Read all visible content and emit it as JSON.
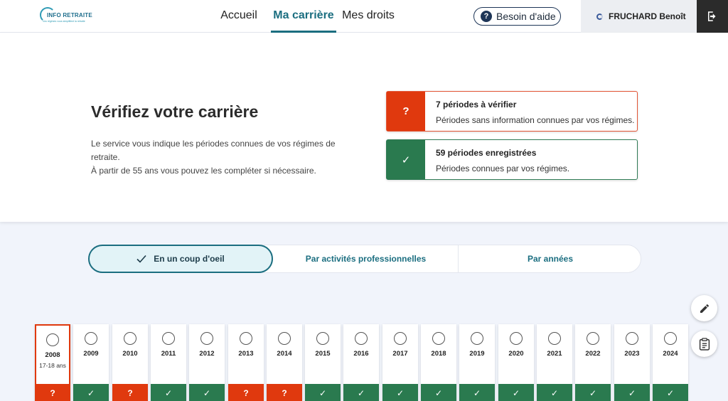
{
  "header": {
    "logo_name": "INFO RETRAITE",
    "logo_tagline": "Vos régimes vous simplifient la retraite",
    "nav": [
      {
        "label": "Accueil",
        "active": false
      },
      {
        "label": "Ma carrière",
        "active": true
      },
      {
        "label": "Mes droits",
        "active": false
      }
    ],
    "help_label": "Besoin d'aide",
    "user_name": "FRUCHARD Benoît"
  },
  "hero": {
    "title": "Vérifiez votre carrière",
    "text_line1": "Le service vous indique les périodes connues de vos régimes de retraite.",
    "text_line2": "À partir de 55 ans vous pouvez les compléter si nécessaire."
  },
  "status_cards": {
    "verify": {
      "title": "7 périodes à vérifier",
      "subtitle": "Périodes sans information connues par vos régimes.",
      "symbol": "?"
    },
    "ok": {
      "title": "59 périodes enregistrées",
      "subtitle": "Périodes connues par vos régimes.",
      "symbol": "✓"
    }
  },
  "tabs": [
    {
      "label": "En un coup d'oeil",
      "active": true
    },
    {
      "label": "Par activités professionnelles",
      "active": false
    },
    {
      "label": "Par années",
      "active": false
    }
  ],
  "colors": {
    "accent": "#1b6e80",
    "verify": "#e0390e",
    "ok": "#2a7a4f"
  },
  "years": [
    {
      "year": "2008",
      "age": "17-18 ans",
      "status": "verify",
      "selected": true
    },
    {
      "year": "2009",
      "age": "",
      "status": "ok",
      "selected": false
    },
    {
      "year": "2010",
      "age": "",
      "status": "verify",
      "selected": false
    },
    {
      "year": "2011",
      "age": "",
      "status": "ok",
      "selected": false
    },
    {
      "year": "2012",
      "age": "",
      "status": "ok",
      "selected": false
    },
    {
      "year": "2013",
      "age": "",
      "status": "verify",
      "selected": false
    },
    {
      "year": "2014",
      "age": "",
      "status": "verify",
      "selected": false
    },
    {
      "year": "2015",
      "age": "",
      "status": "ok",
      "selected": false
    },
    {
      "year": "2016",
      "age": "",
      "status": "ok",
      "selected": false
    },
    {
      "year": "2017",
      "age": "",
      "status": "ok",
      "selected": false
    },
    {
      "year": "2018",
      "age": "",
      "status": "ok",
      "selected": false
    },
    {
      "year": "2019",
      "age": "",
      "status": "ok",
      "selected": false
    },
    {
      "year": "2020",
      "age": "",
      "status": "ok",
      "selected": false
    },
    {
      "year": "2021",
      "age": "",
      "status": "ok",
      "selected": false
    },
    {
      "year": "2022",
      "age": "",
      "status": "ok",
      "selected": false
    },
    {
      "year": "2023",
      "age": "",
      "status": "ok",
      "selected": false
    },
    {
      "year": "2024",
      "age": "",
      "status": "ok",
      "selected": false
    }
  ],
  "symbols": {
    "verify": "?",
    "ok": "✓"
  }
}
